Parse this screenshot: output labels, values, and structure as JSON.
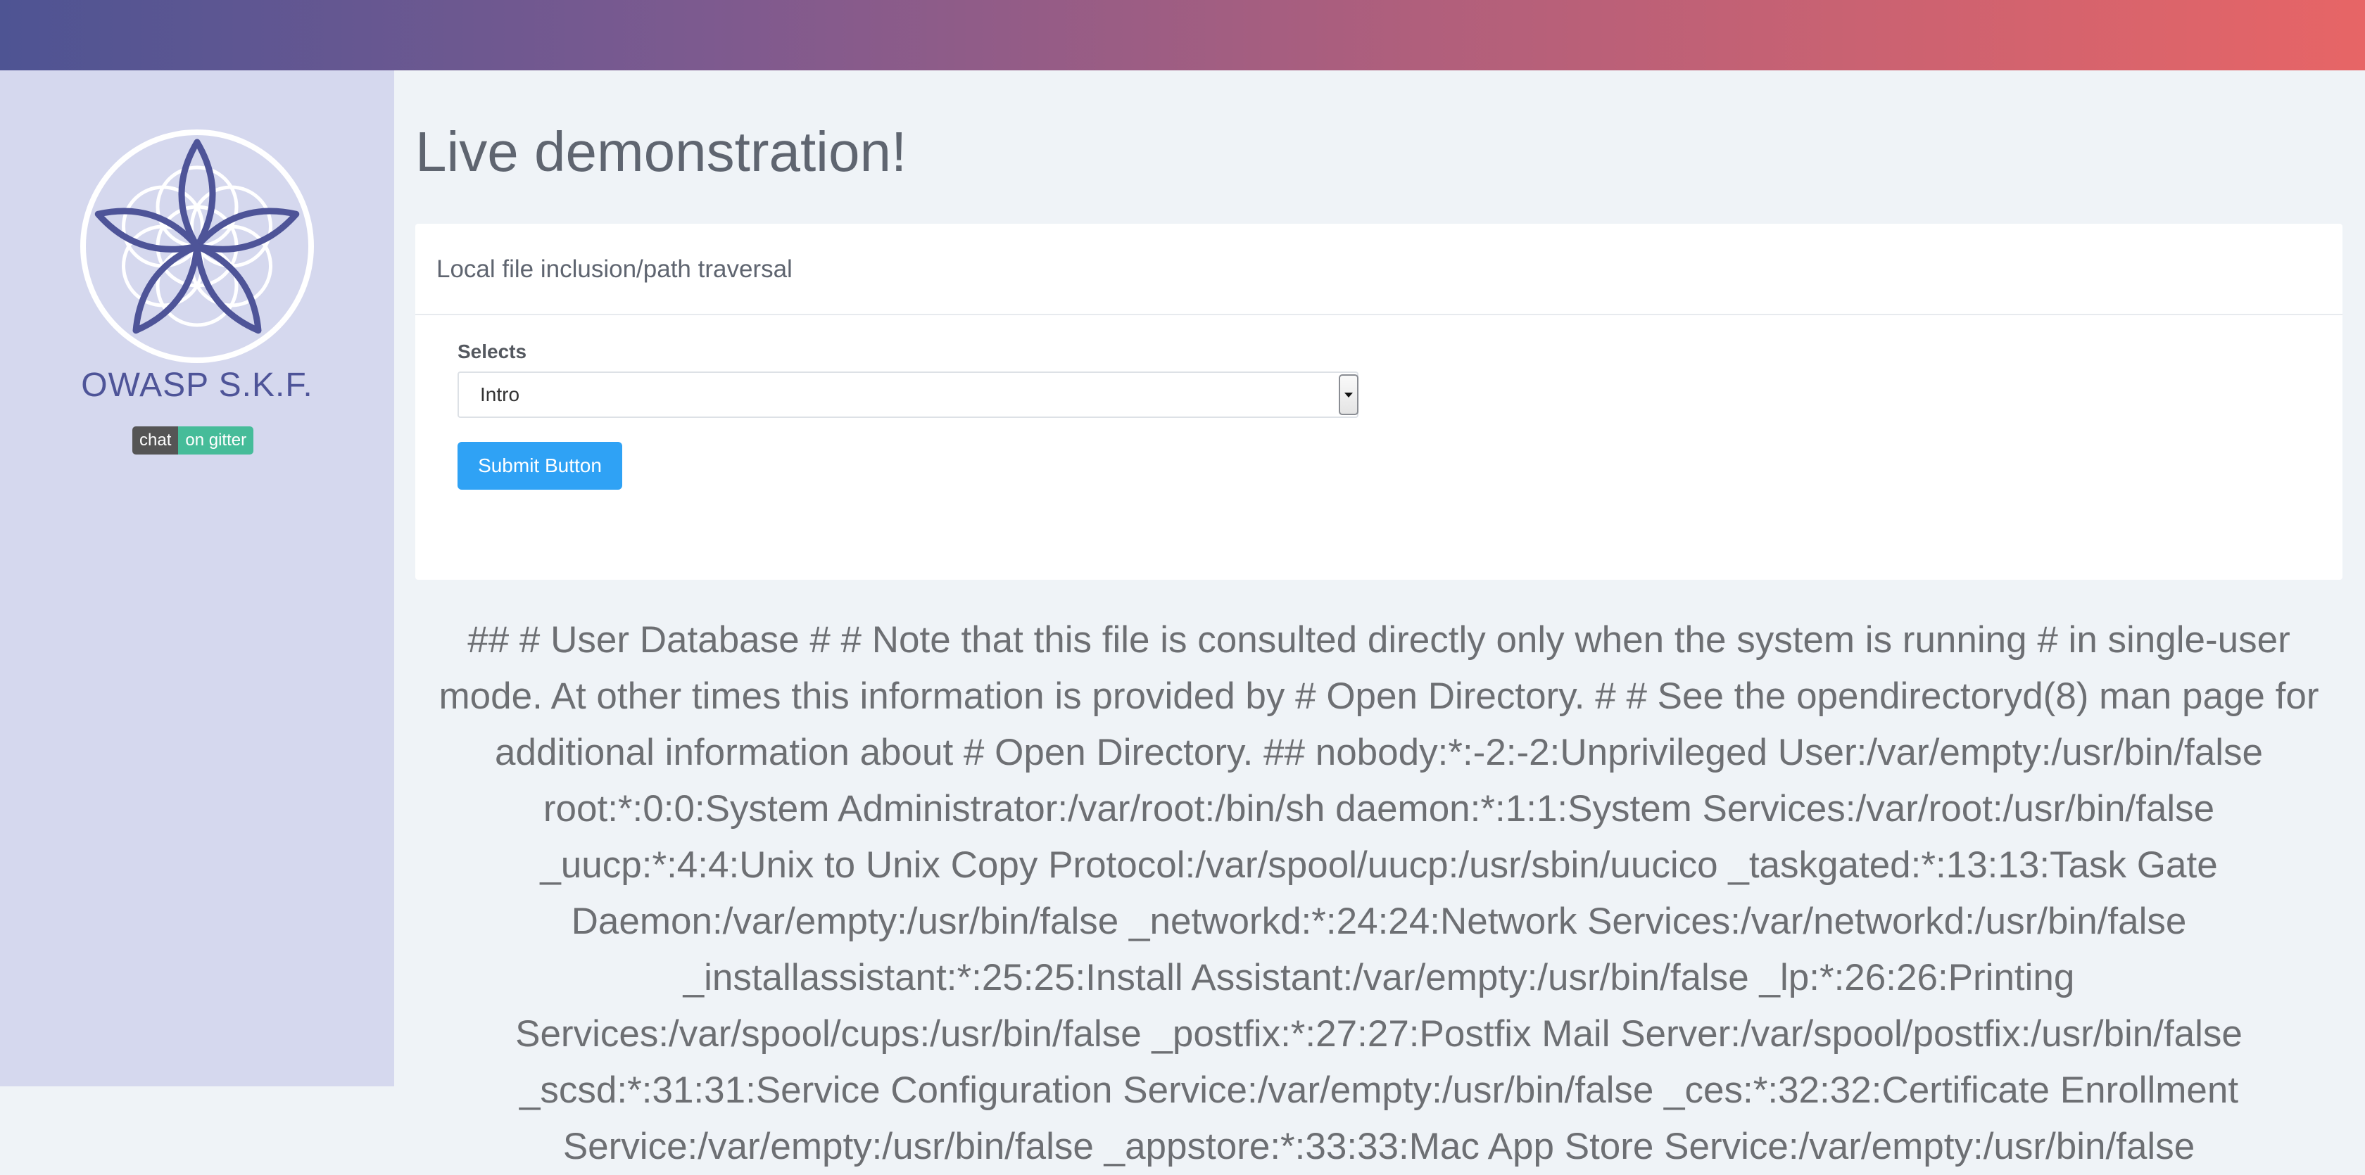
{
  "brand": {
    "name": "OWASP S.K.F.",
    "badge_left": "chat",
    "badge_right": "on gitter",
    "logo_icon": "flower-of-life-icon"
  },
  "page": {
    "title": "Live demonstration!"
  },
  "panel": {
    "header": "Local file inclusion/path traversal",
    "select_label": "Selects",
    "select_value": "Intro",
    "submit_label": "Submit Button"
  },
  "output": {
    "text": "## # User Database # # Note that this file is consulted directly only when the system is running # in single-user mode. At other times this information is provided by # Open Directory. # # See the opendirectoryd(8) man page for additional information about # Open Directory. ## nobody:*:-2:-2:Unprivileged User:/var/empty:/usr/bin/false root:*:0:0:System Administrator:/var/root:/bin/sh daemon:*:1:1:System Services:/var/root:/usr/bin/false _uucp:*:4:4:Unix to Unix Copy Protocol:/var/spool/uucp:/usr/sbin/uucico _taskgated:*:13:13:Task Gate Daemon:/var/empty:/usr/bin/false _networkd:*:24:24:Network Services:/var/networkd:/usr/bin/false _installassistant:*:25:25:Install Assistant:/var/empty:/usr/bin/false _lp:*:26:26:Printing Services:/var/spool/cups:/usr/bin/false _postfix:*:27:27:Postfix Mail Server:/var/spool/postfix:/usr/bin/false _scsd:*:31:31:Service Configuration Service:/var/empty:/usr/bin/false _ces:*:32:32:Certificate Enrollment Service:/var/empty:/usr/bin/false _appstore:*:33:33:Mac App Store Service:/var/empty:/usr/bin/false"
  },
  "colors": {
    "brand": "#4e5498",
    "button": "#2fa2f5",
    "sidebar": "#d5d8ee",
    "background": "#eff3f7"
  }
}
